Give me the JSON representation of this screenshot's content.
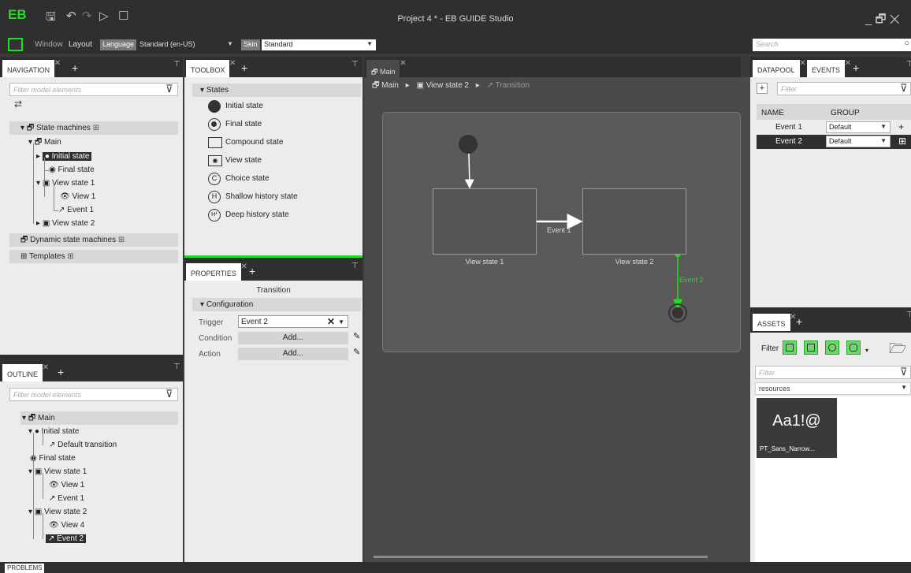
{
  "app": {
    "title": "Project 4 * - EB GUIDE Studio",
    "logo": "EB",
    "window_controls": "_ 🗗 ✕"
  },
  "menubar": {
    "window_label": "Window",
    "layout_label": "Layout",
    "language_label": "Language",
    "language_value": "Standard (en-US)",
    "skin_label": "Skin",
    "skin_value": "Standard",
    "search_placeholder": "Search"
  },
  "navigation": {
    "tab_label": "NAVIGATION",
    "filter_placeholder": "Filter model elements",
    "tree": {
      "state_machines": "State machines",
      "main": "Main",
      "initial_state": "Initial state",
      "final_state": "Final state",
      "view_state_1": "View state 1",
      "view_1": "View 1",
      "event_1": "Event 1",
      "view_state_2": "View state 2",
      "dynamic_state_machines": "Dynamic state machines",
      "templates": "Templates"
    }
  },
  "outline": {
    "tab_label": "OUTLINE",
    "filter_placeholder": "Filter model elements",
    "tree": {
      "main": "Main",
      "initial_state": "Initial state",
      "default_transition": "Default transition",
      "final_state": "Final state",
      "view_state_1": "View state 1",
      "view_1": "View 1",
      "event_1": "Event 1",
      "view_state_2": "View state 2",
      "view_4": "View 4",
      "event_2": "Event 2"
    }
  },
  "toolbox": {
    "tab_label": "TOOLBOX",
    "section": "States",
    "items": [
      "Initial state",
      "Final state",
      "Compound state",
      "View state",
      "Choice state",
      "Shallow history state",
      "Deep history state"
    ]
  },
  "properties": {
    "tab_label": "PROPERTIES",
    "header": "Transition",
    "section": "Configuration",
    "trigger_label": "Trigger",
    "trigger_value": "Event 2",
    "condition_label": "Condition",
    "condition_btn": "Add...",
    "action_label": "Action",
    "action_btn": "Add..."
  },
  "editor": {
    "tab_label": "Main",
    "breadcrumb": [
      "Main",
      "View state 2",
      "Transition"
    ],
    "view_state_1_label": "View state 1",
    "view_state_2_label": "View state 2",
    "event_1_label": "Event 1",
    "event_2_label": "Event 2"
  },
  "datapool": {
    "tab_label": "DATAPOOL",
    "events_tab_label": "EVENTS",
    "filter_placeholder": "Filter",
    "col_name": "NAME",
    "col_group": "GROUP",
    "rows": [
      {
        "name": "Event 1",
        "group": "Default"
      },
      {
        "name": "Event 2",
        "group": "Default"
      }
    ]
  },
  "assets": {
    "tab_label": "ASSETS",
    "filter_label": "Filter",
    "filter_placeholder": "Filter",
    "folder": "resources",
    "font_preview": "Aa1!@",
    "font_name": "PT_Sans_Narrow..."
  },
  "problems": {
    "tab_label": "PROBLEMS"
  },
  "colors": {
    "accent_green": "#22dd22",
    "dark_chrome": "#2f2f2f",
    "canvas": "#4a4a4a",
    "panel": "#ececec"
  }
}
